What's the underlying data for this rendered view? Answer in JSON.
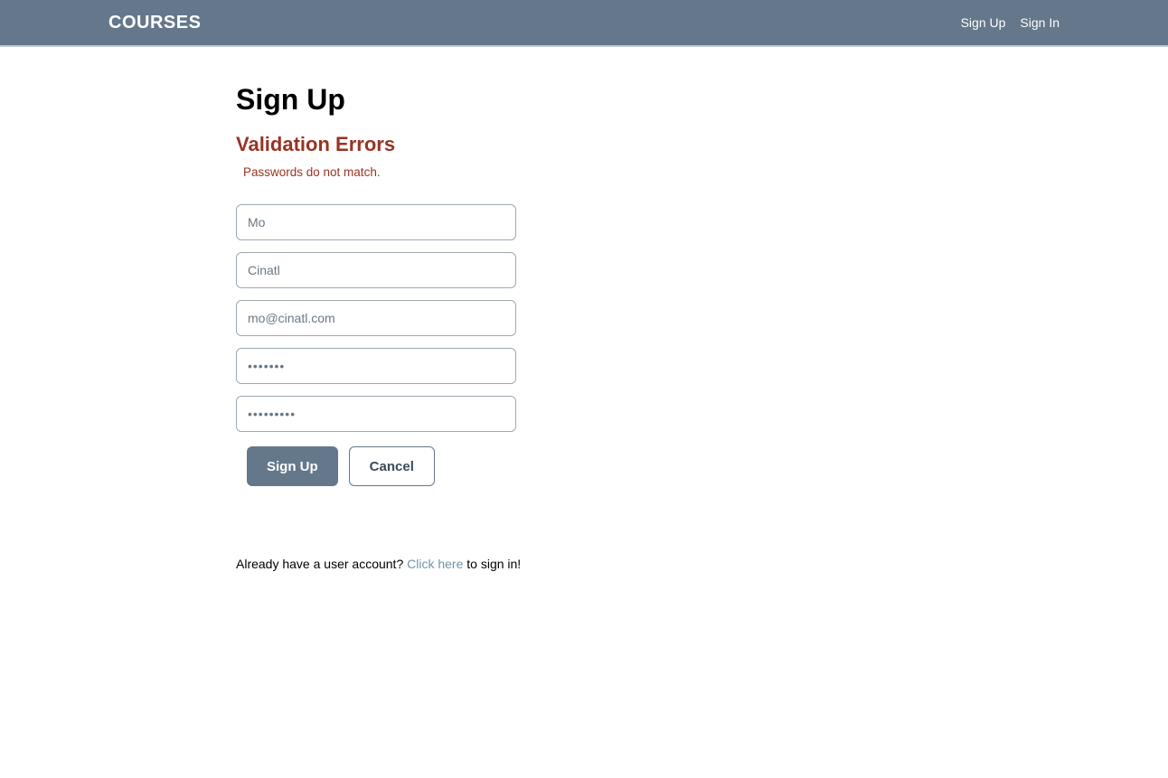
{
  "header": {
    "brand": "COURSES",
    "nav": {
      "signup": "Sign Up",
      "signin": "Sign In"
    }
  },
  "page": {
    "title": "Sign Up"
  },
  "errors": {
    "heading": "Validation Errors",
    "items": [
      "Passwords do not match."
    ]
  },
  "form": {
    "firstName": {
      "value": "Mo"
    },
    "lastName": {
      "value": "Cinatl"
    },
    "email": {
      "value": "mo@cinatl.com"
    },
    "password": {
      "value": "•••••••"
    },
    "confirmPassword": {
      "value": "•••••••••"
    }
  },
  "buttons": {
    "submit": "Sign Up",
    "cancel": "Cancel"
  },
  "footer": {
    "prefix": "Already have a user account? ",
    "linkText": "Click here",
    "suffix": " to sign in!"
  }
}
